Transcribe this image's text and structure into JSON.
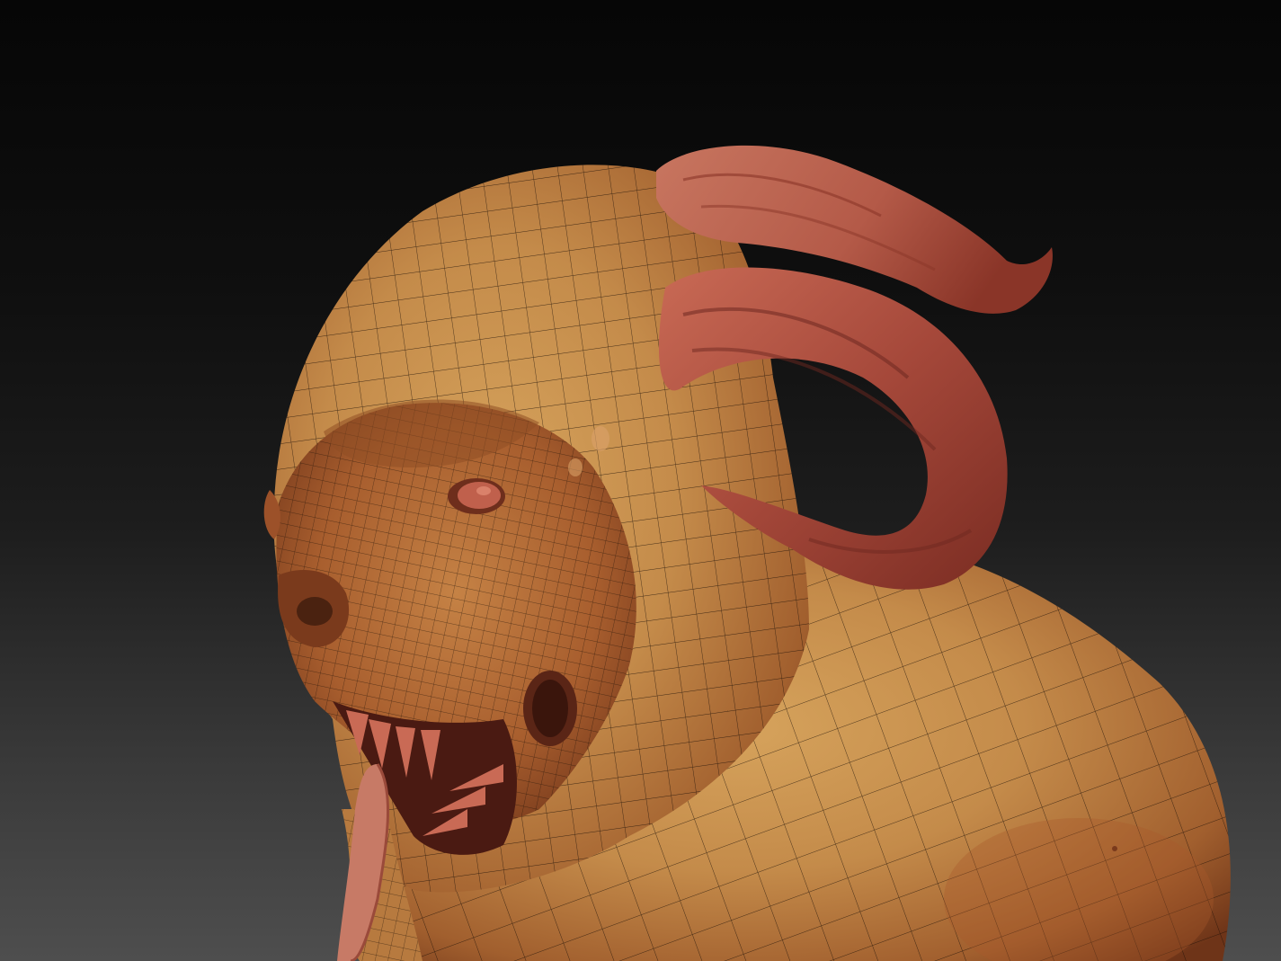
{
  "scene": {
    "subject": "sculpt-creature-bust",
    "colors": {
      "background_top": "#060606",
      "background_bottom": "#4e4e4e",
      "skin_light": "#c9954f",
      "skin_mid": "#b06a33",
      "skin_dark": "#7a3a1c",
      "horn_light": "#c25a46",
      "horn_dark": "#7c2e24",
      "wire": "#1a0e06"
    },
    "icons": {
      "model": "creature-model-icon"
    }
  }
}
